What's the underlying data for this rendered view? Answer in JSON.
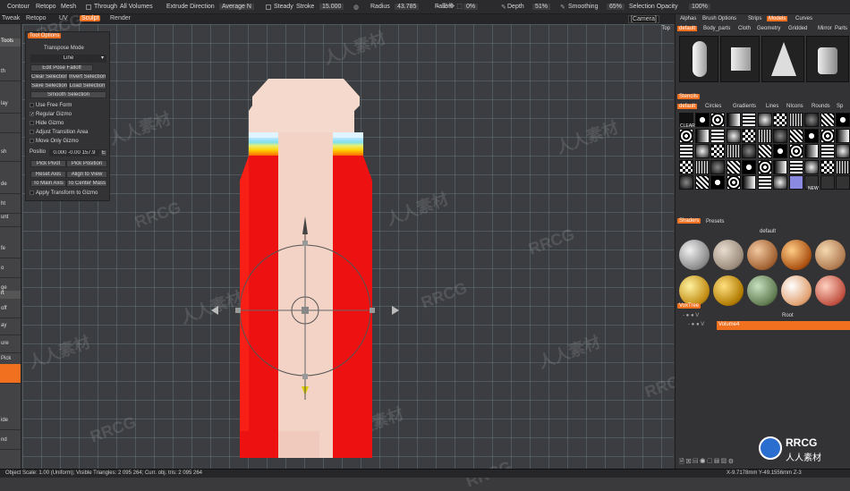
{
  "topbar": {
    "items": [
      "Contour",
      "Retopo",
      "Mesh",
      "Through",
      "All",
      "Volumes",
      "Extrude Direction",
      "Average N",
      "Steady",
      "Stroke",
      "15.000",
      "Radius",
      "43.785",
      "Falloff",
      "0%",
      "Depth",
      "51%",
      "Smoothing",
      "65%",
      "Selection Opacity",
      "100%"
    ],
    "through": "Through",
    "all_volumes": "All Volumes",
    "extrude_label": "Extrude Direction",
    "extrude_value": "Average N",
    "steady_label": "Steady",
    "stroke_label": "Stroke",
    "stroke_value": "15.000",
    "radius_label": "Radius",
    "radius_value": "43.785",
    "falloff_label": "Falloff",
    "falloff_value": "0%",
    "depth_label": "Depth",
    "depth_value": "51%",
    "smoothing_label": "Smoothing",
    "smoothing_value": "65%",
    "selopacity_label": "Selection Opacity",
    "selopacity_value": "100%",
    "contour": "Contour",
    "retopo": "Retopo",
    "mesh": "Mesh"
  },
  "tabs": [
    "Tweak",
    "Retopo",
    "UV",
    "Sculpt",
    "Render"
  ],
  "camera": "[Camera]",
  "viewport": {
    "label": "Top"
  },
  "leftstrip": {
    "items": [
      "Tools",
      "th",
      "lay",
      "sh",
      "de",
      "ht",
      "unt",
      "fe",
      "o",
      "hr",
      "ge",
      "rt",
      "off",
      "ay",
      "ure",
      "Pick",
      "t",
      "ide",
      "nd"
    ]
  },
  "tooloptions": {
    "header": "Tool Options",
    "title": "Transpose Mode",
    "mode": "Line",
    "edit_pose_falloff": "Edit Pose Falloff",
    "clear_selection": "Clear Selection",
    "invert_selection": "Invert Selection",
    "save_selection": "Save Selection",
    "load_selection": "Load Selection",
    "smooth_selection": "Smooth Selection",
    "use_free_form": "Use Free Form",
    "regular_gizmo": "Regular Gizmo",
    "hide_gizmo": "Hide Gizmo",
    "adjust_transition": "Adjust Transition Area",
    "move_only_gizmo": "Move Only Gizmo",
    "position_label": "Positio",
    "position_value": "0.000 -0.00 157.9",
    "pick_pivot": "Pick Pivot",
    "pick_position": "Pick Position",
    "reset_axis": "Reset Axis",
    "align_to_view": "Align to View",
    "to_main_axis": "To Main Axis",
    "to_center_mass": "To Center Mass",
    "apply_transform": "Apply Transform to Gizmo"
  },
  "rightpanel": {
    "tabs": [
      "Alphas",
      "Brush Options",
      "Strips",
      "Models",
      "Curves"
    ],
    "model_tabs": [
      "default",
      "Body_parts",
      "Cloth",
      "Geometry",
      "Gridded",
      "Mirror",
      "Parts"
    ],
    "stencils_header": "Stencils",
    "stencil_tabs": [
      "default",
      "Circles",
      "Gradients",
      "Lines",
      "NIcons",
      "Rounds",
      "Sp"
    ],
    "stencil_clear": "CLEAR",
    "stencil_new": "NEW",
    "shaders_header": "Shaders",
    "presets": "Presets",
    "shader_default": "default",
    "voxtree_header": "VoxTree",
    "root": "Root",
    "volume": "Volume4"
  },
  "status": {
    "left": "Object Scale: 1.00 (Uniform); Visible Triangles: 2 095 264; Curr. obj. tris: 2 095 264",
    "right": "X-9.7178mm Y-49.1556mm Z-3"
  },
  "watermark": {
    "text1": "RRCG",
    "text2": "人人素材"
  },
  "logo": {
    "text1": "RRCG",
    "text2": "人人素材"
  },
  "colors": {
    "accent": "#f07020",
    "model_red": "#ee1111",
    "model_skin": "#f5d9cc"
  }
}
